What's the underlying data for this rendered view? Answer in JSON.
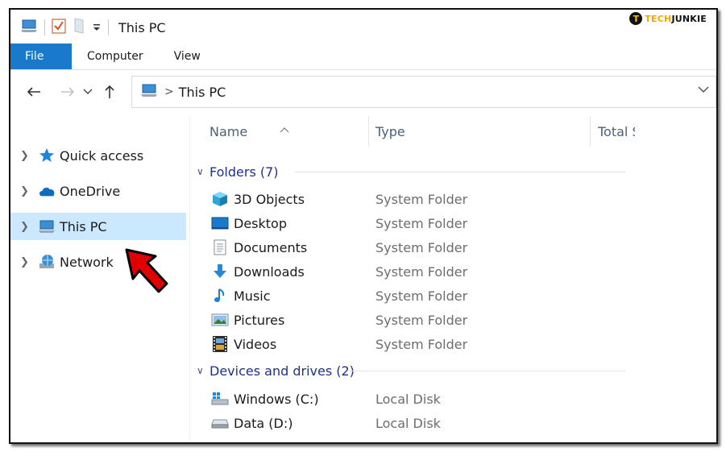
{
  "window": {
    "title": "This PC"
  },
  "watermark": {
    "logo_letter": "T",
    "brand_a": "TECH",
    "brand_b": "JUNKIE"
  },
  "ribbon": {
    "tabs": [
      "File",
      "Computer",
      "View"
    ]
  },
  "address": {
    "location": "This PC",
    "separator": ">"
  },
  "nav_pane": {
    "items": [
      {
        "label": "Quick access",
        "icon": "star-icon"
      },
      {
        "label": "OneDrive",
        "icon": "cloud-icon"
      },
      {
        "label": "This PC",
        "icon": "computer-icon",
        "selected": true
      },
      {
        "label": "Network",
        "icon": "network-icon"
      }
    ]
  },
  "columns": {
    "name": "Name",
    "type": "Type",
    "total": "Total S"
  },
  "groups": {
    "folders": {
      "label": "Folders (7)",
      "items": [
        {
          "name": "3D Objects",
          "type": "System Folder",
          "icon": "3d-objects-icon"
        },
        {
          "name": "Desktop",
          "type": "System Folder",
          "icon": "desktop-icon"
        },
        {
          "name": "Documents",
          "type": "System Folder",
          "icon": "documents-icon"
        },
        {
          "name": "Downloads",
          "type": "System Folder",
          "icon": "downloads-icon"
        },
        {
          "name": "Music",
          "type": "System Folder",
          "icon": "music-icon"
        },
        {
          "name": "Pictures",
          "type": "System Folder",
          "icon": "pictures-icon"
        },
        {
          "name": "Videos",
          "type": "System Folder",
          "icon": "videos-icon"
        }
      ]
    },
    "drives": {
      "label": "Devices and drives (2)",
      "items": [
        {
          "name": "Windows (C:)",
          "type": "Local Disk",
          "icon": "windows-drive-icon"
        },
        {
          "name": "Data (D:)",
          "type": "Local Disk",
          "icon": "drive-icon"
        }
      ]
    }
  },
  "colors": {
    "accent": "#1979ca",
    "selected_bg": "#cce8ff",
    "annotation_arrow": "#e00000"
  }
}
